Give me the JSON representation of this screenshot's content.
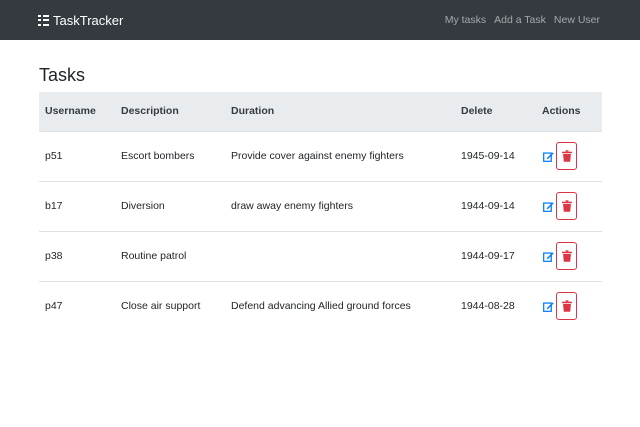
{
  "navbar": {
    "brand": "TaskTracker",
    "links": [
      "My tasks",
      "Add a Task",
      "New User"
    ]
  },
  "page": {
    "title": "Tasks"
  },
  "table": {
    "headers": [
      "Username",
      "Description",
      "Duration",
      "Delete",
      "Actions"
    ],
    "rows": [
      [
        "p51",
        "Escort bombers",
        "Provide cover against enemy fighters",
        "1945-09-14"
      ],
      [
        "b17",
        "Diversion",
        "draw away enemy fighters",
        "1944-09-14"
      ],
      [
        "p38",
        "Routine patrol",
        "",
        "1944-09-17"
      ],
      [
        "p47",
        "Close air support",
        "Defend advancing Allied ground forces",
        "1944-08-28"
      ]
    ]
  },
  "icons": {
    "brand": "list-icon",
    "edit": "edit-icon",
    "delete": "trash-icon"
  },
  "colors": {
    "navbar_bg": "#343a40",
    "header_bg": "#e9ecef",
    "edit_blue": "#007bff",
    "delete_red": "#dc3545"
  }
}
